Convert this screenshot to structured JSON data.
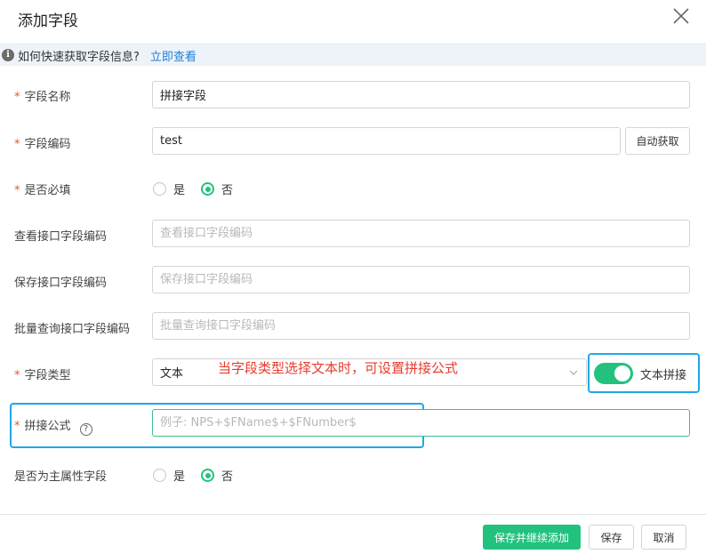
{
  "dialog": {
    "title": "添加字段",
    "close_icon": "close-icon"
  },
  "info": {
    "text": "如何快速获取字段信息?",
    "link": "立即查看",
    "icon_glyph": "i"
  },
  "fields": {
    "name": {
      "label": "字段名称",
      "value": "拼接字段"
    },
    "code": {
      "label": "字段编码",
      "value": "test",
      "auto_button": "自动获取"
    },
    "required": {
      "label": "是否必填",
      "options": [
        "是",
        "否"
      ],
      "selected": "否"
    },
    "view_code": {
      "label": "查看接口字段编码",
      "placeholder": "查看接口字段编码"
    },
    "save_code": {
      "label": "保存接口字段编码",
      "placeholder": "保存接口字段编码"
    },
    "batch_code": {
      "label": "批量查询接口字段编码",
      "placeholder": "批量查询接口字段编码"
    },
    "type": {
      "label": "字段类型",
      "value": "文本",
      "toggle_label": "文本拼接",
      "toggle_on": true
    },
    "formula": {
      "label": "拼接公式",
      "help_glyph": "?",
      "placeholder": "例子: NPS+$FName$+$FNumber$"
    },
    "primary": {
      "label": "是否为主属性字段",
      "options": [
        "是",
        "否"
      ],
      "selected": "否"
    }
  },
  "annotation": "当字段类型选择文本时，可设置拼接公式",
  "footer": {
    "save_continue": "保存并继续添加",
    "save": "保存",
    "cancel": "取消"
  },
  "colors": {
    "primary": "#22c27e",
    "highlight": "#1ea8e6",
    "annotation": "#e63b2e",
    "link": "#1f7ed2"
  }
}
